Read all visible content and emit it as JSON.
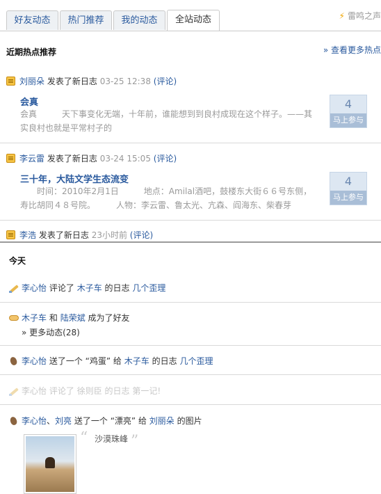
{
  "tabs": [
    "好友动态",
    "热门推荐",
    "我的动态",
    "全站动态"
  ],
  "voice": {
    "label": "雷鸣之声",
    "icon": "lightning-icon"
  },
  "hot": {
    "title": "近期热点推荐",
    "more": "» 查看更多热点",
    "items": [
      {
        "user": "刘丽朵",
        "action": "发表了新日志",
        "time": "03-25 12:38",
        "comment": "(评论)",
        "title": "会真",
        "body": "会真　　　天下事变化无端，十年前，谁能想到到良村成现在这个样子。——其实良村也就是平常村子的",
        "count": "4",
        "join": "马上参与"
      },
      {
        "user": "李云雷",
        "action": "发表了新日志",
        "time": "03-24 15:05",
        "comment": "(评论)",
        "title": "三十年，大陆文学生态流变",
        "body": "　　时间：2010年2月1日　　　地点：Amilal酒吧，鼓楼东大街６６号东侧，寿比胡同４８号院。　　　人物：李云雷、鲁太光、亢森、阎海东、柴春芽",
        "count": "4",
        "join": "马上参与"
      },
      {
        "user": "李浩",
        "action": "发表了新日志",
        "time": "23小时前",
        "comment": "(评论)"
      }
    ]
  },
  "today": {
    "title": "今天",
    "items": [
      {
        "actor": "李心怡",
        "verb": "评论了",
        "target": "木子车",
        "mid": "的日志",
        "obj": "几个歪理"
      },
      {
        "actor": "木子车",
        "and": "和",
        "actor2": "陆荣斌",
        "verb": "成为了好友",
        "more": "» 更多动态(28)"
      },
      {
        "actor": "李心怡",
        "verb": "送了一个 “鸡蛋” 给",
        "target": "木子车",
        "mid": "的日志",
        "obj": "几个歪理"
      },
      {
        "actor": "李心怡",
        "verb": "评论了",
        "target": "徐则臣",
        "mid": "的日志",
        "obj": "第一记!"
      },
      {
        "actor": "李心怡",
        "sep": "、",
        "actor2": "刘亮",
        "verb": "送了一个 “漂亮” 给",
        "target": "刘丽朵",
        "mid": "的图片",
        "caption": "沙漠珠峰"
      }
    ]
  }
}
